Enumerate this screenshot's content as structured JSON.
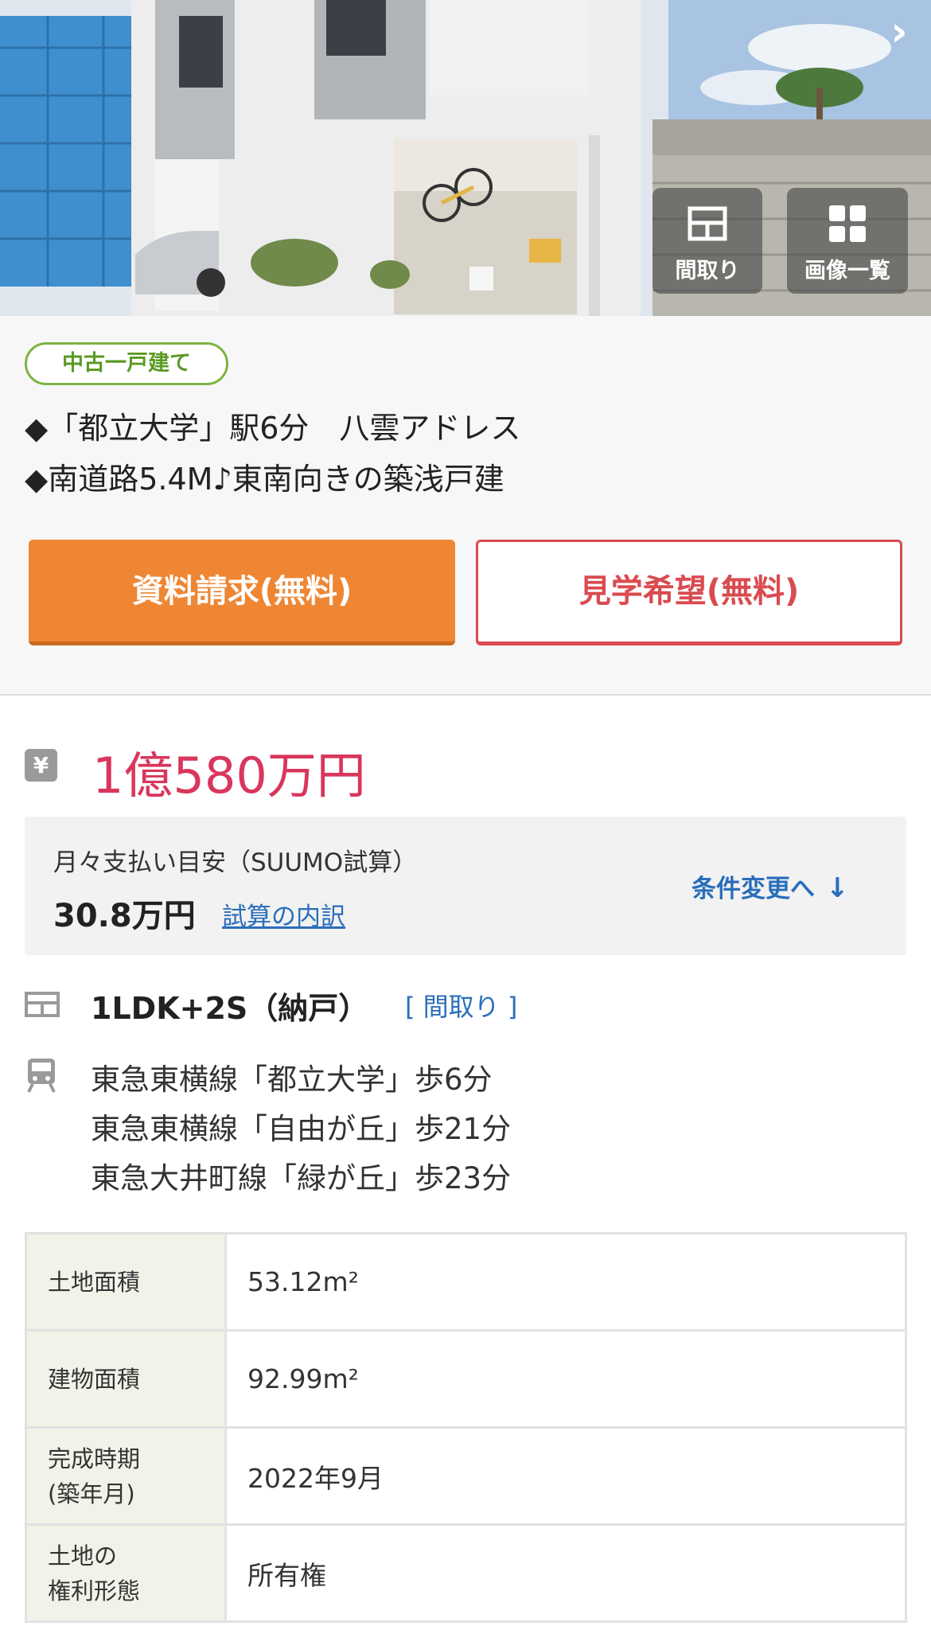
{
  "hero": {
    "floorplan_label": "間取り",
    "gallery_label": "画像一覧"
  },
  "summary": {
    "property_type": "中古一戸建て",
    "catch_lines": [
      "◆「都立大学」駅6分　八雲アドレス",
      "◆南道路5.4M♪東南向きの築浅戸建"
    ],
    "request_button": "資料請求(無料)",
    "visit_button": "見学希望(無料)"
  },
  "price": {
    "icon": "¥",
    "value": "1億580万円"
  },
  "payment": {
    "label": "月々支払い目安（SUUMO試算）",
    "amount": "30.8万円",
    "breakdown_link": "試算の内訳",
    "change_link": "条件変更へ",
    "change_arrow": "↓"
  },
  "layout": {
    "value": "1LDK+2S（納戸）",
    "link": "[ 間取り ]"
  },
  "access": [
    "東急東横線「都立大学」歩6分",
    "東急東横線「自由が丘」歩21分",
    "東急大井町線「緑が丘」歩23分"
  ],
  "specs": [
    {
      "label": "土地面積",
      "value": "53.12m²"
    },
    {
      "label": "建物面積",
      "value": "92.99m²"
    },
    {
      "label": "完成時期\n(築年月)",
      "value": "2022年9月"
    },
    {
      "label": "土地の\n権利形態",
      "value": "所有権"
    }
  ],
  "colors": {
    "accent_orange": "#ee8633",
    "accent_red": "#d94b50",
    "price_pink": "#d9365c",
    "link_blue": "#2a6ebb",
    "badge_green": "#7cb342"
  },
  "icons": [
    "chevron-right-icon",
    "floorplan-icon",
    "grid-icon",
    "yen-icon",
    "train-icon",
    "arrow-down-icon"
  ]
}
